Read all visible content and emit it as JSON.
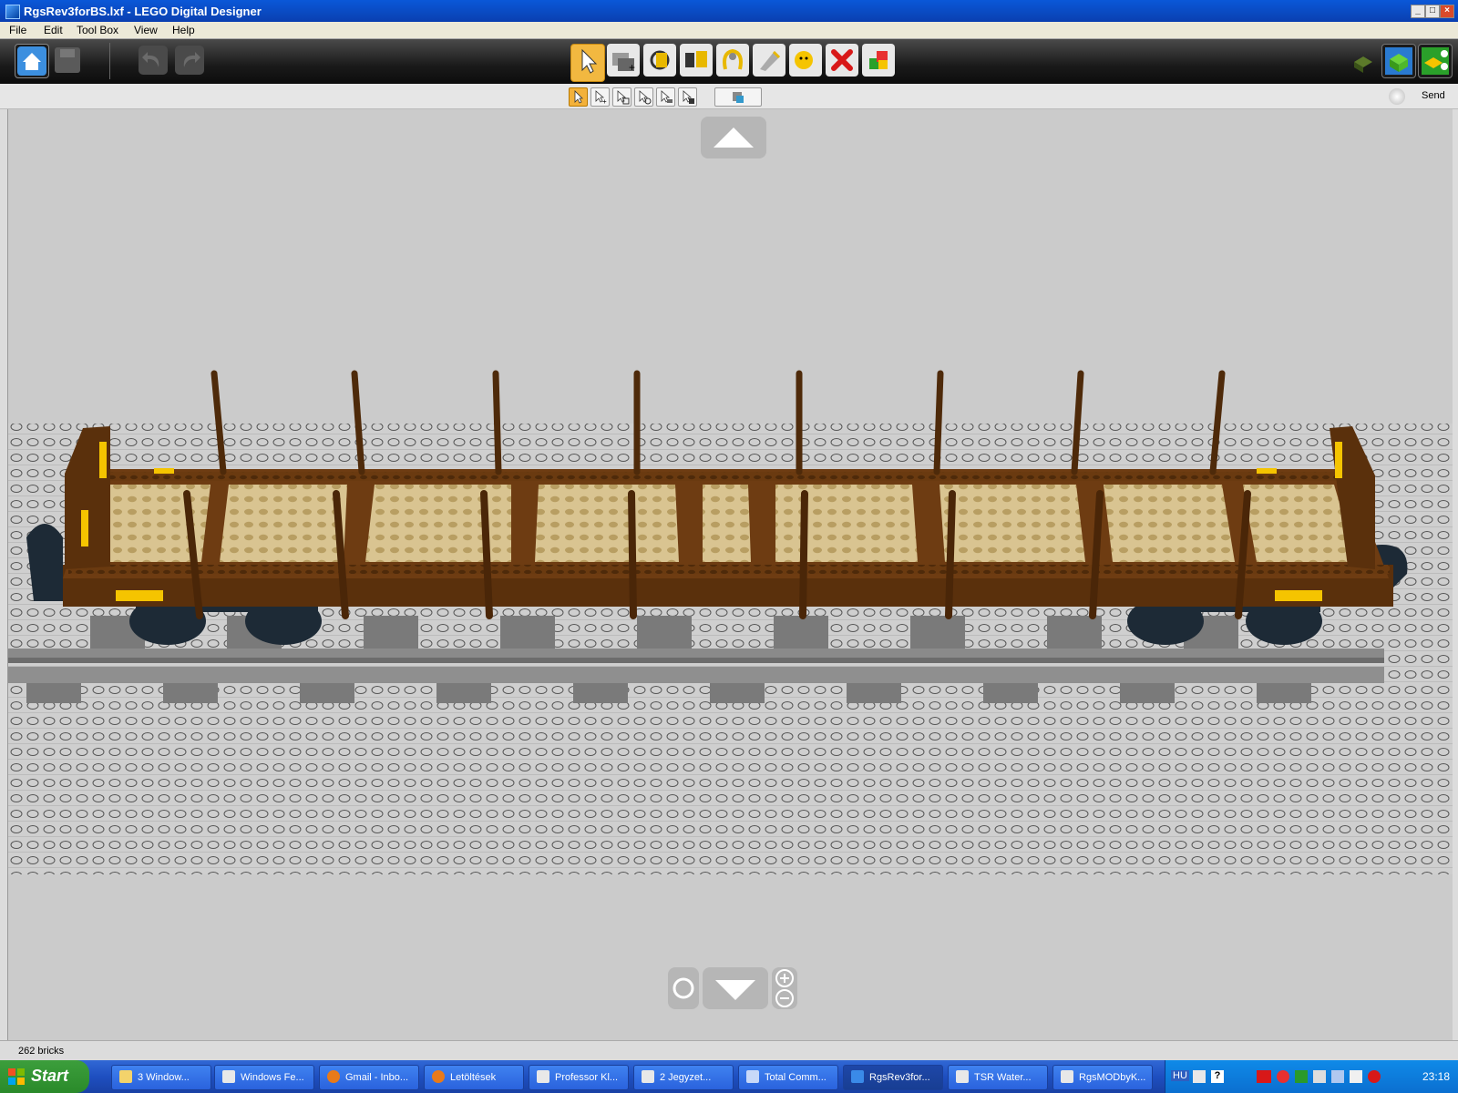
{
  "window": {
    "title": "RgsRev3forBS.lxf - LEGO Digital Designer"
  },
  "menu": {
    "items": [
      "File",
      "Edit",
      "Tool Box",
      "View",
      "Help"
    ]
  },
  "toolbar": {
    "send_label": "Send",
    "left_icons": [
      "home-icon",
      "save-icon",
      "undo-icon",
      "redo-icon"
    ],
    "tool_icons": [
      "select-arrow-icon",
      "clone-icon",
      "hinge-icon",
      "hinge-align-icon",
      "flex-icon",
      "paint-icon",
      "hide-icon",
      "delete-icon",
      "colour-picker-icon"
    ],
    "right_icons": [
      "build-mode-icon",
      "view-mode-icon",
      "building-guide-icon"
    ]
  },
  "statusbar": {
    "brick_count": "262 bricks"
  },
  "taskbar": {
    "start_label": "Start",
    "tasks": [
      "3 Window...",
      "Windows Fe...",
      "Gmail - Inbo...",
      "Letöltések",
      "Professor Kl...",
      "2 Jegyzet...",
      "Total Comm...",
      "RgsRev3for...",
      "TSR Water...",
      "RgsMODbyK..."
    ],
    "language": "HU",
    "clock": "23:18"
  },
  "colors": {
    "title_bar": "#0a4fc4",
    "wagon_brown": "#6a3a10",
    "wagon_tan": "#d8c28e",
    "accent_yellow": "#f5c400",
    "baseplate": "#c8c8c8"
  }
}
